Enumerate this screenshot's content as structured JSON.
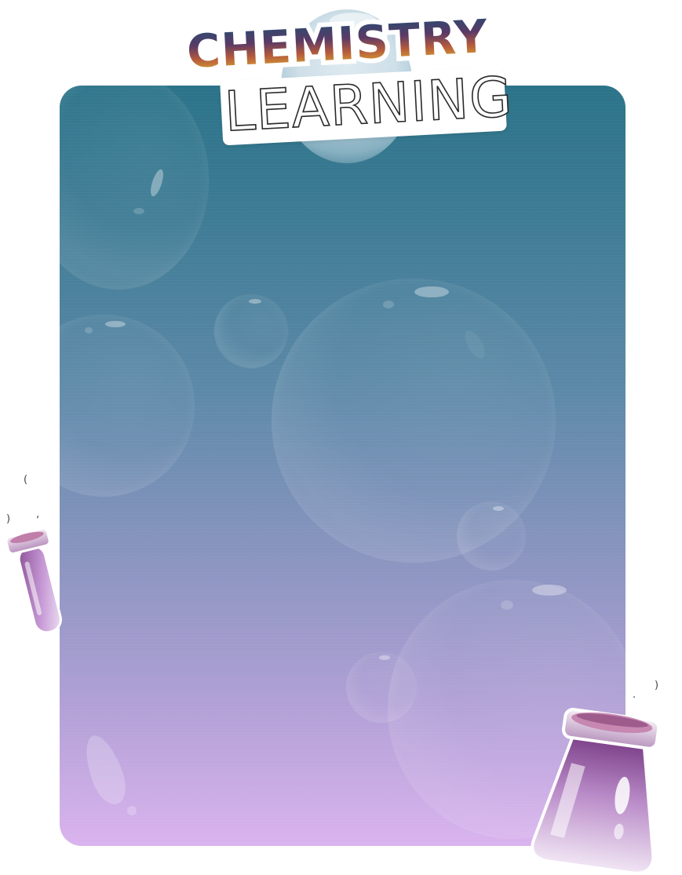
{
  "logo": {
    "line1": "CHEMISTRY",
    "line2": "LEARNING"
  },
  "colors": {
    "panel_top": "#2b7389",
    "panel_bottom": "#dab3ee",
    "flask_glass": "#c99bd6",
    "flask_rim": "#e8d4ea"
  },
  "icons": {
    "small_flask": "test-tube-icon",
    "large_flask": "beaker-icon"
  }
}
